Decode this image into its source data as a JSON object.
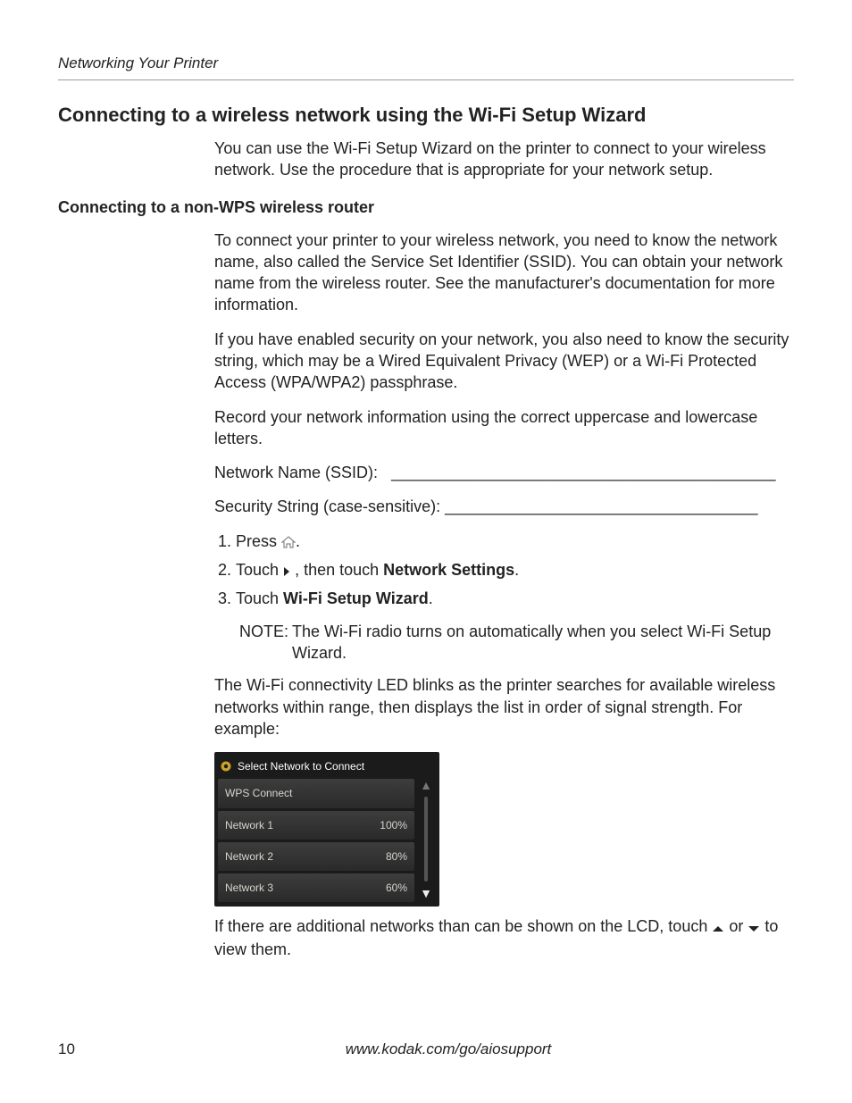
{
  "running_head": "Networking Your Printer",
  "section_title": "Connecting to a wireless network using the Wi-Fi Setup Wizard",
  "intro": "You can use the Wi-Fi Setup Wizard on the printer to connect to your wireless network. Use the procedure that is appropriate for your network setup.",
  "sub_title": "Connecting to a non-WPS wireless router",
  "p1": "To connect your printer to your wireless network, you need to know the network name, also called the Service Set Identifier (SSID). You can obtain your network name from the wireless router. See the manufacturer's documentation for more information.",
  "p2": "If you have enabled security on your network, you also need to know the security string, which may be a Wired Equivalent Privacy (WEP) or a Wi-Fi Protected Access (WPA/WPA2) passphrase.",
  "p3": "Record your network information using the correct uppercase and lowercase letters.",
  "field_ssid_label": "Network Name (SSID):",
  "field_ssid_blank": "___________________________________________",
  "field_sec_label": "Security String (case-sensitive):",
  "field_sec_blank": "___________________________________",
  "step1_a": "Press ",
  "step1_b": ".",
  "step2_a": "Touch ",
  "step2_b": " , then touch ",
  "step2_bold": "Network Settings",
  "step2_c": ".",
  "step3_a": "Touch ",
  "step3_bold": "Wi-Fi Setup Wizard",
  "step3_b": ".",
  "note_label": "NOTE:",
  "note_text": "The Wi-Fi radio turns on automatically when you select Wi-Fi Setup Wizard.",
  "p4": "The Wi-Fi connectivity LED blinks as the printer searches for available wireless networks within range, then displays the list in order of signal strength. For example:",
  "lcd": {
    "title": "Select Network to Connect",
    "rows": [
      {
        "name": "WPS Connect",
        "signal": ""
      },
      {
        "name": "Network 1",
        "signal": "100%"
      },
      {
        "name": "Network 2",
        "signal": "80%"
      },
      {
        "name": "Network 3",
        "signal": "60%"
      }
    ]
  },
  "p5_a": "If there are additional networks than can be shown on the LCD, touch ",
  "p5_b": " or ",
  "p5_c": " to view them.",
  "page_number": "10",
  "footer_url": "www.kodak.com/go/aiosupport"
}
